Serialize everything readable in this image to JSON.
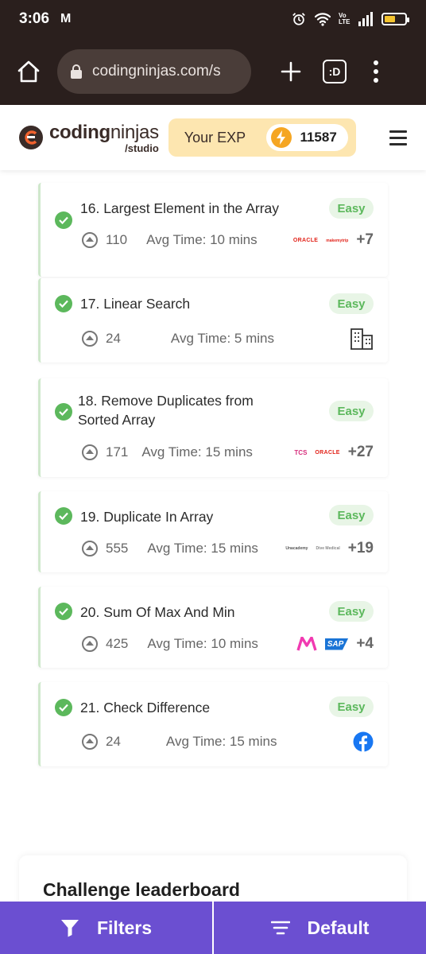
{
  "status_bar": {
    "time": "3:06",
    "mail_icon": "gmail-icon",
    "network": "Vo LTE"
  },
  "browser": {
    "url": "codingninjas.com/s",
    "tab_count": ":D"
  },
  "header": {
    "brand": "codingninjas",
    "brand_bold": "coding",
    "brand_light": "ninjas",
    "sub": "/studio",
    "exp_label": "Your EXP",
    "exp_value": "11587",
    "accent": "#fde6b0"
  },
  "problems": [
    {
      "title": "16. Largest Element in the Array",
      "difficulty": "Easy",
      "upvotes": "110",
      "avg_time": "Avg Time: 10 mins",
      "companies": [
        "ORACLE",
        "makemytrip"
      ],
      "more": "+7"
    },
    {
      "title": "17. Linear Search",
      "difficulty": "Easy",
      "upvotes": "24",
      "avg_time": "Avg Time: 5 mins",
      "companies": [
        "building-icon"
      ],
      "more": ""
    },
    {
      "title": "18. Remove Duplicates from Sorted Array",
      "difficulty": "Easy",
      "upvotes": "171",
      "avg_time": "Avg Time: 15 mins",
      "companies": [
        "TCS",
        "ORACLE"
      ],
      "more": "+27"
    },
    {
      "title": "19. Duplicate In Array",
      "difficulty": "Easy",
      "upvotes": "555",
      "avg_time": "Avg Time: 15 mins",
      "companies": [
        "Unacademy",
        "Dive Medical"
      ],
      "more": "+19"
    },
    {
      "title": "20. Sum Of Max And Min",
      "difficulty": "Easy",
      "upvotes": "425",
      "avg_time": "Avg Time: 10 mins",
      "companies": [
        "myntra",
        "SAP"
      ],
      "more": "+4"
    },
    {
      "title": "21. Check Difference",
      "difficulty": "Easy",
      "upvotes": "24",
      "avg_time": "Avg Time: 15 mins",
      "companies": [
        "facebook"
      ],
      "more": ""
    }
  ],
  "leaderboard": {
    "title": "Challenge leaderboard"
  },
  "bottom_bar": {
    "filters_label": "Filters",
    "sort_label": "Default",
    "color": "#6b4fd1"
  },
  "colors": {
    "easy": "#5cb85c",
    "solved_border": "#cfe8cc",
    "browser_bg": "#2a1f1d"
  }
}
